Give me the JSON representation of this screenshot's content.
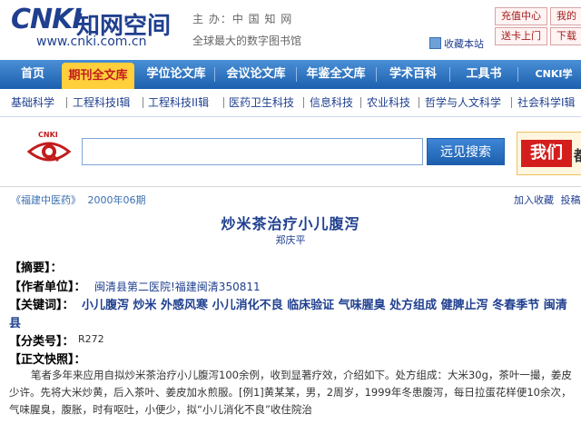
{
  "header": {
    "logo_latin": "CNKI",
    "logo_cn": "知网空间",
    "logo_url": "www.cnki.com.cn",
    "host": "主 办：中 国 知 网",
    "slogan": "全球最大的数字图书馆",
    "favorite": "收藏本站",
    "buttons": {
      "recharge": "充值中心",
      "mymall": "我的",
      "card": "送卡上门",
      "dl": "下载"
    }
  },
  "nav": {
    "items": [
      "首页",
      "期刊全文库",
      "学位论文库",
      "会议论文库",
      "年鉴全文库",
      "学术百科",
      "工具书",
      "CNKI学"
    ]
  },
  "subnav": {
    "items": [
      "基础科学",
      "工程科技I辑",
      "工程科技II辑",
      "医药卫生科技",
      "信息科技",
      "农业科技",
      "哲学与人文科学",
      "社会科学I辑"
    ]
  },
  "search": {
    "button_label": "远见搜索",
    "placeholder": "",
    "ad_text": "我们",
    "ad_text2": "都"
  },
  "article": {
    "journal": "《福建中医药》",
    "issue": "2000年06期",
    "action_favorite": "加入收藏",
    "action_submit": "投稿",
    "title": "炒米茶治疗小儿腹泻",
    "author": "郑庆平",
    "label_abstract": "【摘要】：",
    "label_unit": "【作者单位】：",
    "unit": "闽清县第二医院!福建闽清350811",
    "label_keywords": "【关键词】：",
    "keywords_line1": "小儿腹泻 炒米 外感风寒 小儿消化不良 临床验证 气味腥臭 处方组成 健脾止泻 冬春季节 闽清",
    "keywords_line2": "县",
    "label_class": "【分类号】：",
    "class_no": "R272",
    "label_preview": "【正文快照】：",
    "preview": "笔者多年来应用自拟炒米茶治疗小儿腹泻100余例，收到显著疗效，介绍如下。处方组成：大米30g，茶叶一撮，姜皮少许。先将大米炒黄，后入茶叶、姜皮加水煎服。[例1]黄某某，男，2周岁，1999年冬患腹泻，每日拉蛋花样便10余次，气味腥臭，腹胀，时有呕吐，小便少，拟“小儿消化不良”收住院治"
  }
}
